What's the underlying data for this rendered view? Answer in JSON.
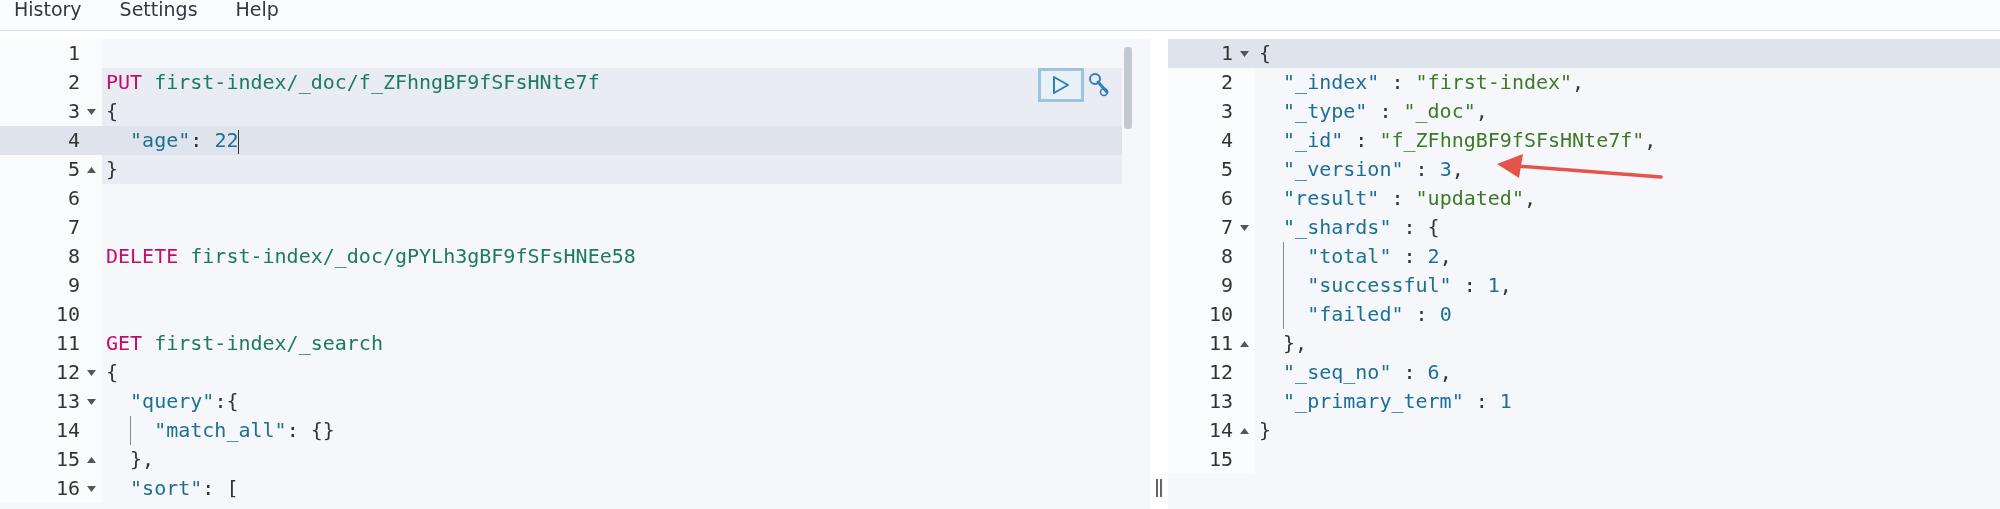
{
  "menu": [
    {
      "label": "History"
    },
    {
      "label": "Settings"
    },
    {
      "label": "Help"
    }
  ],
  "request_editor": {
    "lines": [
      {
        "n": "1",
        "block": false,
        "active": false
      },
      {
        "n": "2",
        "block": true,
        "active": false,
        "tokens": [
          {
            "kind": "method",
            "text": "PUT"
          },
          {
            "kind": "path",
            "text": " first-index/_doc/f_ZFhngBF9fSFsHNte7f"
          }
        ]
      },
      {
        "n": "3",
        "fold_start": true,
        "block": true,
        "active": false,
        "tokens": [
          {
            "kind": "punct",
            "text": "{"
          }
        ]
      },
      {
        "n": "4",
        "block": true,
        "active": true,
        "cursor": true,
        "tokens": [
          {
            "kind": "key",
            "text": "  \"age\""
          },
          {
            "kind": "punct",
            "text": ": "
          },
          {
            "kind": "number",
            "text": "22"
          }
        ]
      },
      {
        "n": "5",
        "fold_end": true,
        "block": true,
        "active": false,
        "tokens": [
          {
            "kind": "punct",
            "text": "}"
          }
        ]
      },
      {
        "n": "6",
        "block": false,
        "active": false
      },
      {
        "n": "7",
        "block": false,
        "active": false
      },
      {
        "n": "8",
        "block": false,
        "active": false,
        "tokens": [
          {
            "kind": "method",
            "text": "DELETE"
          },
          {
            "kind": "path",
            "text": " first-index/_doc/gPYLh3gBF9fSFsHNEe58"
          }
        ]
      },
      {
        "n": "9",
        "block": false,
        "active": false
      },
      {
        "n": "10",
        "block": false,
        "active": false
      },
      {
        "n": "11",
        "block": false,
        "active": false,
        "tokens": [
          {
            "kind": "method",
            "text": "GET"
          },
          {
            "kind": "path",
            "text": " first-index/_search"
          }
        ]
      },
      {
        "n": "12",
        "fold_start": true,
        "block": false,
        "active": false,
        "tokens": [
          {
            "kind": "punct",
            "text": "{"
          }
        ]
      },
      {
        "n": "13",
        "fold_start": true,
        "block": false,
        "active": false,
        "tokens": [
          {
            "kind": "key",
            "text": "  \"query\""
          },
          {
            "kind": "punct",
            "text": ":{"
          }
        ]
      },
      {
        "n": "14",
        "block": false,
        "active": false,
        "guide": true,
        "tokens": [
          {
            "kind": "key",
            "text": "    \"match_all\""
          },
          {
            "kind": "punct",
            "text": ": {}"
          }
        ]
      },
      {
        "n": "15",
        "fold_end": true,
        "block": false,
        "active": false,
        "tokens": [
          {
            "kind": "punct",
            "text": "  },"
          }
        ]
      },
      {
        "n": "16",
        "fold_start": true,
        "block": false,
        "active": false,
        "tokens": [
          {
            "kind": "key",
            "text": "  \"sort\""
          },
          {
            "kind": "punct",
            "text": ": ["
          }
        ]
      }
    ]
  },
  "response_editor": {
    "lines": [
      {
        "n": "1",
        "fold_start": true,
        "active": true,
        "tokens": [
          {
            "kind": "punct",
            "text": "{"
          }
        ]
      },
      {
        "n": "2",
        "active": false,
        "tokens": [
          {
            "kind": "key",
            "text": "  \"_index\""
          },
          {
            "kind": "punct",
            "text": " : "
          },
          {
            "kind": "string",
            "text": "\"first-index\""
          },
          {
            "kind": "punct",
            "text": ","
          }
        ]
      },
      {
        "n": "3",
        "active": false,
        "tokens": [
          {
            "kind": "key",
            "text": "  \"_type\""
          },
          {
            "kind": "punct",
            "text": " : "
          },
          {
            "kind": "string",
            "text": "\"_doc\""
          },
          {
            "kind": "punct",
            "text": ","
          }
        ]
      },
      {
        "n": "4",
        "active": false,
        "tokens": [
          {
            "kind": "key",
            "text": "  \"_id\""
          },
          {
            "kind": "punct",
            "text": " : "
          },
          {
            "kind": "string",
            "text": "\"f_ZFhngBF9fSFsHNte7f\""
          },
          {
            "kind": "punct",
            "text": ","
          }
        ]
      },
      {
        "n": "5",
        "active": false,
        "marked": true,
        "tokens": [
          {
            "kind": "key",
            "text": "  \"_version\""
          },
          {
            "kind": "punct",
            "text": " : "
          },
          {
            "kind": "number",
            "text": "3"
          },
          {
            "kind": "punct",
            "text": ","
          }
        ]
      },
      {
        "n": "6",
        "active": false,
        "tokens": [
          {
            "kind": "key",
            "text": "  \"result\""
          },
          {
            "kind": "punct",
            "text": " : "
          },
          {
            "kind": "string",
            "text": "\"updated\""
          },
          {
            "kind": "punct",
            "text": ","
          }
        ]
      },
      {
        "n": "7",
        "fold_start": true,
        "active": false,
        "tokens": [
          {
            "kind": "key",
            "text": "  \"_shards\""
          },
          {
            "kind": "punct",
            "text": " : {"
          }
        ]
      },
      {
        "n": "8",
        "active": false,
        "guide": true,
        "tokens": [
          {
            "kind": "key",
            "text": "    \"total\""
          },
          {
            "kind": "punct",
            "text": " : "
          },
          {
            "kind": "number",
            "text": "2"
          },
          {
            "kind": "punct",
            "text": ","
          }
        ]
      },
      {
        "n": "9",
        "active": false,
        "guide": true,
        "tokens": [
          {
            "kind": "key",
            "text": "    \"successful\""
          },
          {
            "kind": "punct",
            "text": " : "
          },
          {
            "kind": "number",
            "text": "1"
          },
          {
            "kind": "punct",
            "text": ","
          }
        ]
      },
      {
        "n": "10",
        "active": false,
        "guide": true,
        "tokens": [
          {
            "kind": "key",
            "text": "    \"failed\""
          },
          {
            "kind": "punct",
            "text": " : "
          },
          {
            "kind": "number",
            "text": "0"
          }
        ]
      },
      {
        "n": "11",
        "fold_end": true,
        "active": false,
        "tokens": [
          {
            "kind": "punct",
            "text": "  },"
          }
        ]
      },
      {
        "n": "12",
        "active": false,
        "tokens": [
          {
            "kind": "key",
            "text": "  \"_seq_no\""
          },
          {
            "kind": "punct",
            "text": " : "
          },
          {
            "kind": "number",
            "text": "6"
          },
          {
            "kind": "punct",
            "text": ","
          }
        ]
      },
      {
        "n": "13",
        "active": false,
        "tokens": [
          {
            "kind": "key",
            "text": "  \"_primary_term\""
          },
          {
            "kind": "punct",
            "text": " : "
          },
          {
            "kind": "number",
            "text": "1"
          }
        ]
      },
      {
        "n": "14",
        "fold_end": true,
        "active": false,
        "tokens": [
          {
            "kind": "punct",
            "text": "}"
          }
        ]
      },
      {
        "n": "15",
        "active": false
      }
    ]
  }
}
